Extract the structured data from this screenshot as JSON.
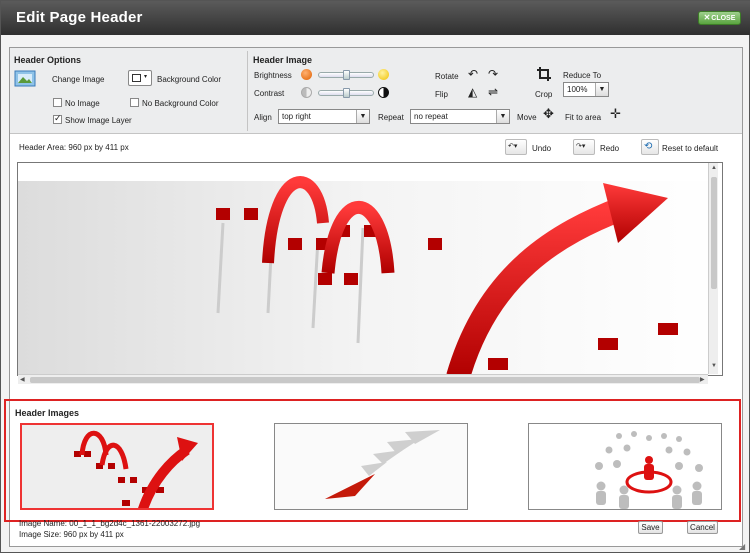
{
  "window": {
    "title": "Edit Page Header",
    "close_label": "CLOSE"
  },
  "header_options": {
    "title": "Header Options",
    "change_image": "Change Image",
    "background_color": "Background Color",
    "no_image": "No Image",
    "no_background_color": "No Background Color",
    "show_image_layer": "Show Image Layer",
    "show_image_layer_checked": true
  },
  "header_image": {
    "title": "Header Image",
    "brightness": "Brightness",
    "contrast": "Contrast",
    "brightness_level": 0.5,
    "contrast_level": 0.5,
    "rotate": "Rotate",
    "flip": "Flip",
    "crop": "Crop",
    "reduce_to": "Reduce To",
    "reduce_value": "100%",
    "align_label": "Align",
    "align_value": "top right",
    "repeat_label": "Repeat",
    "repeat_value": "no repeat",
    "move": "Move",
    "fit_to_area": "Fit to area"
  },
  "area_info": "Header Area: 960 px by 411 px",
  "actions": {
    "undo": "Undo",
    "redo": "Redo",
    "reset": "Reset to default"
  },
  "header_images": {
    "title": "Header Images",
    "items": [
      {
        "name": "hurdles-arrow",
        "selected": true
      },
      {
        "name": "paper-planes",
        "selected": false
      },
      {
        "name": "crowd-target",
        "selected": false
      }
    ],
    "image_name": "Image Name: 00_1_1_bg2d4c_1361-22003272.jpg",
    "image_size": "Image Size: 960 px by 411 px"
  },
  "footer": {
    "save": "Save",
    "cancel": "Cancel"
  },
  "colors": {
    "accent_red": "#d22222",
    "close_green": "#5aa43f",
    "titlebar": "#3a3a3a"
  }
}
